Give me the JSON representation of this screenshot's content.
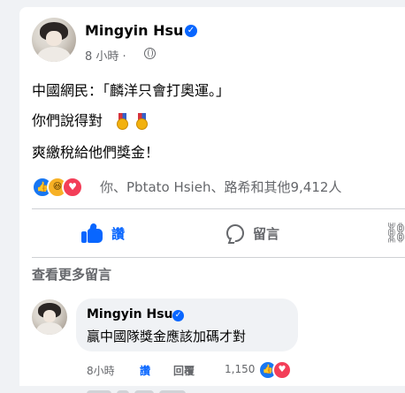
{
  "post": {
    "author": "Mingyin Hsu",
    "time": "8 小時 · ",
    "privacy_icon": "globe-icon",
    "lines": [
      "中國網民：「麟洋只會打奧運。」",
      "你們說得對",
      "爽繳稅給他們獎金！"
    ],
    "line2_emoji": "gold-medal-icon ×2"
  },
  "reactions": {
    "types": [
      "like",
      "haha",
      "love"
    ],
    "summary": "你、Pbtato Hsieh、路希和其他9,412人"
  },
  "actions": {
    "like_label": "讚",
    "comment_label": "留言",
    "share_icon": "share-icon"
  },
  "comments": {
    "view_more": "查看更多留言",
    "items": [
      {
        "author": "Mingyin Hsu",
        "text": "贏中國隊獎金應該加碼才對",
        "time": "8小時",
        "like_label": "讚",
        "reply_label": "回覆",
        "reaction_count": "1,150"
      }
    ]
  },
  "colors": {
    "accent": "#0866ff",
    "text_secondary": "#65676b",
    "love": "#f33e58",
    "haha": "#f7b125"
  }
}
